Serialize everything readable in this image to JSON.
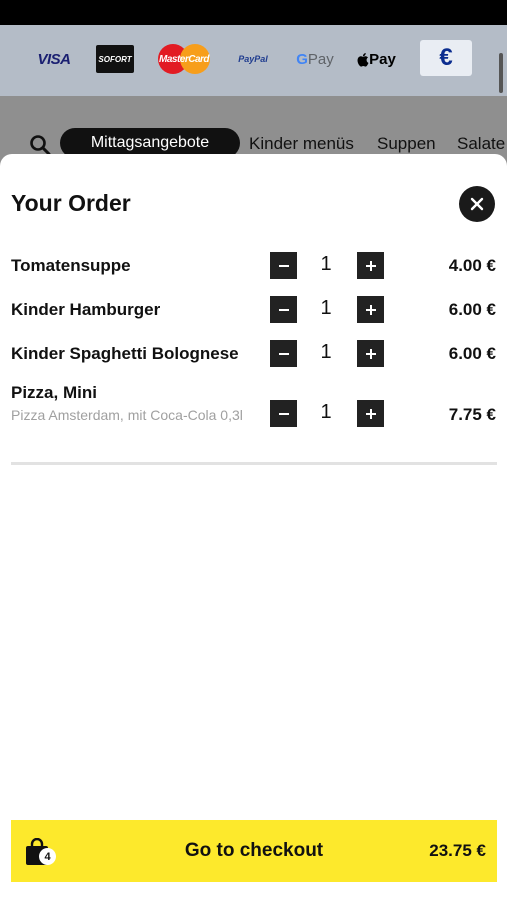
{
  "payment_methods": {
    "visa": "VISA",
    "sofort": "SOFORT",
    "mastercard": "MasterCard",
    "paypal": "PayPal",
    "gpay_g": "G",
    "gpay_text": "Pay",
    "applepay": "Pay",
    "euro": "€"
  },
  "categories": {
    "active": "Mittagsangebote",
    "items": [
      "Kinder menüs",
      "Suppen",
      "Salate"
    ]
  },
  "order": {
    "title": "Your Order",
    "items": [
      {
        "name": "Tomatensuppe",
        "qty": "1",
        "price": "4.00 €"
      },
      {
        "name": "Kinder Hamburger",
        "qty": "1",
        "price": "6.00 €"
      },
      {
        "name": "Kinder Spaghetti Bolognese",
        "qty": "1",
        "price": "6.00 €"
      },
      {
        "name": "Pizza, Mini",
        "description": "Pizza Amsterdam, mit Coca-Cola 0,3l",
        "qty": "1",
        "price": "7.75 €"
      }
    ]
  },
  "checkout": {
    "label": "Go to checkout",
    "item_count": "4",
    "total": "23.75 €"
  },
  "colors": {
    "accent": "#fde92c",
    "dark": "#1a1a1a"
  }
}
